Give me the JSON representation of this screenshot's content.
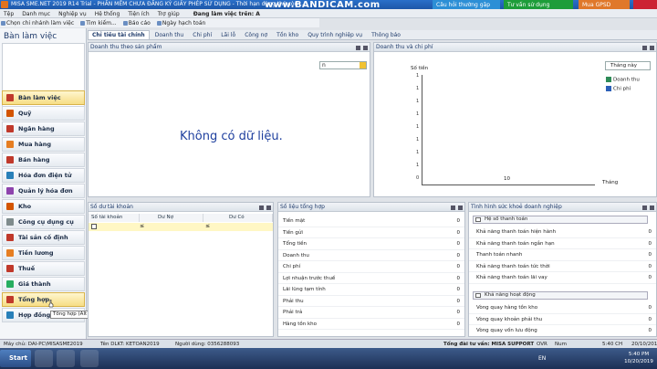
{
  "window": {
    "title": "MISA SME.NET 2019 R14 Trial - PHẦN MỀM CHƯA ĐĂNG KÝ GIẤY PHÉP SỬ DỤNG - Thời hạn dùng thử còn ...",
    "overlay": "www.BANDICAM.com",
    "top_buttons": [
      "Câu hỏi thường gặp",
      "Tư vấn sử dụng",
      "Mua GPSD"
    ]
  },
  "menu": {
    "items": [
      "Tệp",
      "Danh mục",
      "Nghiệp vụ",
      "Hệ thống",
      "Tiện ích",
      "Trợ giúp"
    ],
    "unit_label": "Đang làm việc trên: A"
  },
  "toolbar": {
    "items": [
      "Chọn chi nhánh làm việc",
      "Tìm kiếm...",
      "Báo cáo",
      "Ngày hạch toán"
    ]
  },
  "sidebar": {
    "title": "Bàn làm việc",
    "items": [
      "Bàn làm việc",
      "Quỹ",
      "Ngân hàng",
      "Mua hàng",
      "Bán hàng",
      "Hóa đơn điện tử",
      "Quản lý hóa đơn",
      "Kho",
      "Công cụ dụng cụ",
      "Tài sản cố định",
      "Tiền lương",
      "Thuế",
      "Giá thành",
      "Tổng hợp",
      "Hợp đồng"
    ],
    "tooltip": "Tổng hợp (Alt + F3)"
  },
  "tabs": [
    "Chỉ tiêu tài chính",
    "Doanh thu",
    "Chi phí",
    "Lãi lỗ",
    "Công nợ",
    "Tồn kho",
    "Quy trình nghiệp vụ",
    "Thông báo"
  ],
  "panels": {
    "revenue_by_product": {
      "title": "Doanh thu theo sản phẩm",
      "combo_value": "n",
      "empty_message": "Không có dữ liệu."
    },
    "revenue_expense": {
      "title": "Doanh thu và chi phí",
      "period": "Tháng này",
      "y_title": "Số tiền",
      "y_ticks": [
        "1",
        "1",
        "1",
        "1",
        "1",
        "1",
        "1",
        "1",
        "0"
      ],
      "x_value": "10",
      "x_title": "Tháng",
      "legend": [
        {
          "label": "Doanh thu",
          "color": "#2e8b57"
        },
        {
          "label": "Chi phí",
          "color": "#2b5fb8"
        }
      ]
    },
    "account_balance": {
      "title": "Số dư tài khoản",
      "columns": [
        "Số tài khoản",
        "Dư Nợ",
        "Dư Có"
      ],
      "filter_symbol": "≤"
    },
    "summary_figures": {
      "title": "Số liệu tổng hợp",
      "rows": [
        {
          "label": "Tiền mặt",
          "value": "0"
        },
        {
          "label": "Tiền gửi",
          "value": "0"
        },
        {
          "label": "Tổng tiền",
          "value": "0"
        },
        {
          "label": "Doanh thu",
          "value": "0"
        },
        {
          "label": "Chi phí",
          "value": "0"
        },
        {
          "label": "Lợi nhuận trước thuế",
          "value": "0"
        },
        {
          "label": "Lãi lũng tạm tính",
          "value": "0"
        },
        {
          "label": "Phải thu",
          "value": "0"
        },
        {
          "label": "Phải trả",
          "value": "0"
        },
        {
          "label": "Hàng tồn kho",
          "value": "0"
        }
      ]
    },
    "business_health": {
      "title": "Tình hình sức khoẻ doanh nghiệp",
      "section1": "Hệ số thanh toán",
      "section1_rows": [
        {
          "label": "Khả năng thanh toán hiện hành",
          "value": "0"
        },
        {
          "label": "Khả năng thanh toán ngắn hạn",
          "value": "0"
        },
        {
          "label": "Thanh toán nhanh",
          "value": "0"
        },
        {
          "label": "Khả năng thanh toán tức thời",
          "value": "0"
        },
        {
          "label": "Khả năng thanh toán lãi vay",
          "value": "0"
        }
      ],
      "section2": "Khả năng hoạt động",
      "section2_rows": [
        {
          "label": "Vòng quay hàng tồn kho",
          "value": "0"
        },
        {
          "label": "Vòng quay khoản phải thu",
          "value": "0"
        },
        {
          "label": "Vòng quay vốn lưu động",
          "value": "0"
        }
      ]
    }
  },
  "statusbar": {
    "machine": "Máy chủ: DAI-PC\\MISASME2019",
    "db": "Tên DLKT: KETOAN2019",
    "user": "Người dùng: 0356288093",
    "support": "Tổng đài tư vấn: MISA SUPPORT",
    "mode": "OVR",
    "language": "Num",
    "time": "5:40 CH",
    "date": "20/10/201"
  },
  "taskbar": {
    "start": "Start",
    "lang": "EN",
    "clock_time": "5:40 PM",
    "clock_date": "10/20/2019"
  }
}
